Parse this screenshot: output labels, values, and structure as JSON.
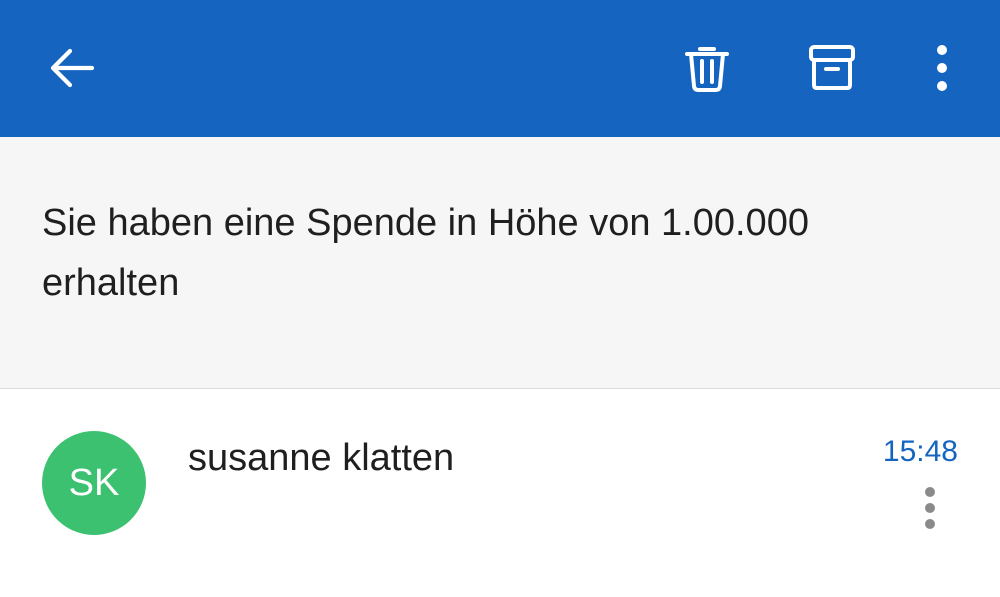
{
  "toolbar": {
    "background_color": "#1565c0",
    "icons": {
      "back": "arrow-left-icon",
      "delete": "trash-icon",
      "archive": "archive-icon",
      "more": "more-vertical-icon"
    }
  },
  "message": {
    "subject": "Sie haben eine Spende in Höhe von 1.00.000 erhalten",
    "sender": {
      "initials": "SK",
      "name": "susanne klatten",
      "avatar_color": "#3cc170"
    },
    "time": "15:48"
  }
}
